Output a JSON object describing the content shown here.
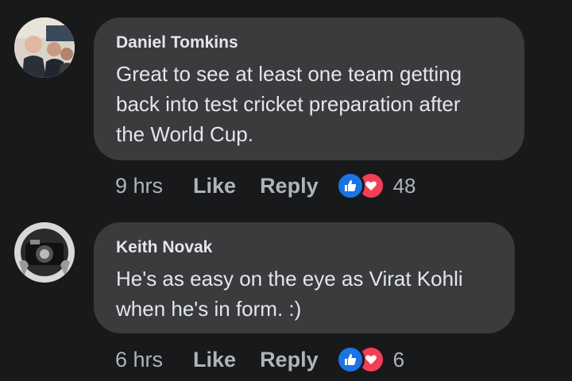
{
  "comments": [
    {
      "author": "Daniel Tomkins",
      "text": "Great to see at least one team getting\nback into test cricket preparation after\nthe World Cup.",
      "time": "9 hrs",
      "like_label": "Like",
      "reply_label": "Reply",
      "reaction_count": "48"
    },
    {
      "author": "Keith Novak",
      "text": "He's as easy on the eye as Virat Kohli\nwhen he's in form. :)",
      "time": "6 hrs",
      "like_label": "Like",
      "reply_label": "Reply",
      "reaction_count": "6"
    }
  ],
  "reactions": {
    "like_icon": "thumbs-up-icon",
    "love_icon": "heart-icon",
    "like_color": "#1b74e4",
    "love_color": "#f33e58"
  },
  "colors": {
    "background": "#18191a",
    "bubble": "#3a3b3c",
    "text": "#e4e6eb",
    "muted": "#b0b3b8"
  }
}
